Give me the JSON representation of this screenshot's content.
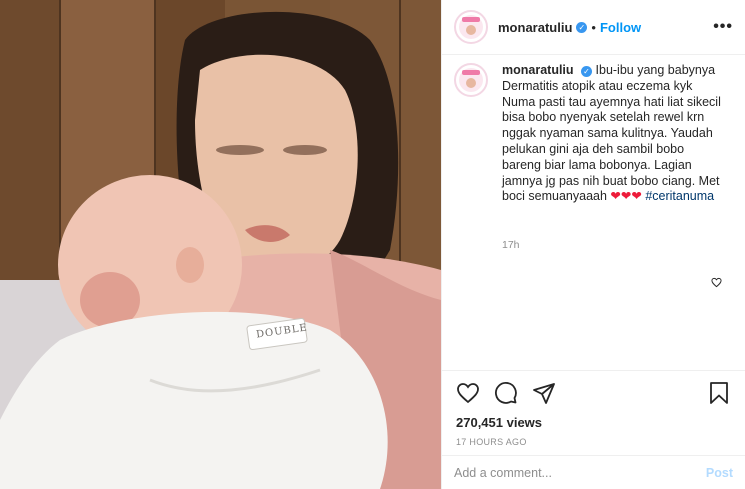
{
  "header": {
    "username": "monaratuliu",
    "separator": "•",
    "follow_label": "Follow",
    "more_label": "•••"
  },
  "caption": {
    "username": "monaratuliu",
    "text": "Ibu-ibu yang babynya Dermatitis atopik atau eczema kyk Numa pasti tau ayemnya hati liat sikecil bisa bobo nyenyak setelah rewel krn nggak nyaman sama kulitnya. Yaudah pelukan gini aja deh sambil bobo bareng biar lama bobonya. Lagian jamnya jg pas nih buat bobo ciang. Met boci semuanyaaah",
    "hearts": "❤❤❤",
    "hashtag": "#ceritanuma",
    "time": "17h"
  },
  "photo": {
    "label_on_clothes": "DOUBLE"
  },
  "stats": {
    "views": "270,451 views",
    "posted": "17 HOURS AGO"
  },
  "comment": {
    "placeholder": "Add a comment...",
    "post_label": "Post"
  },
  "icons": [
    "heart-icon",
    "comment-icon",
    "share-icon",
    "bookmark-icon",
    "verified-badge-icon",
    "small-heart-icon"
  ],
  "colors": {
    "accent": "#0095f6",
    "verified": "#3897f0",
    "hashtag": "#00376b",
    "muted": "#8e8e8e",
    "heart_emoji": "#ed1c3a",
    "post_disabled": "#b3dbff"
  }
}
